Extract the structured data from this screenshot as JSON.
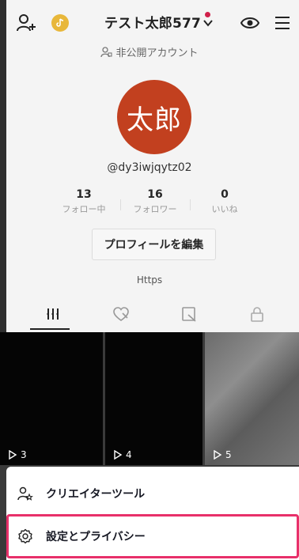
{
  "header": {
    "username": "テスト太郎577",
    "icons": [
      "add-user-icon",
      "coin-icon",
      "chevron-down-icon",
      "eye-icon",
      "hamburger-menu-icon"
    ]
  },
  "profile": {
    "account_type": "非公開アカウント",
    "avatar_text": "太郎",
    "handle": "@dy3iwjqytz02",
    "stats": [
      {
        "value": "13",
        "label": "フォロー中"
      },
      {
        "value": "16",
        "label": "フォロワー"
      },
      {
        "value": "0",
        "label": "いいね"
      }
    ],
    "edit_button": "プロフィールを編集",
    "bio": "Https"
  },
  "tabs": [
    "grid-icon",
    "liked-icon",
    "favorites-icon",
    "lock-icon"
  ],
  "videos": [
    {
      "plays": "3"
    },
    {
      "plays": "4"
    },
    {
      "plays": "5"
    }
  ],
  "sheet": {
    "items": [
      {
        "label": "クリエイターツール"
      },
      {
        "label": "設定とプライバシー"
      }
    ]
  },
  "colors": {
    "avatar_bg": "#c2401f",
    "highlight": "#e8306a",
    "notification_dot": "#d0204a"
  }
}
